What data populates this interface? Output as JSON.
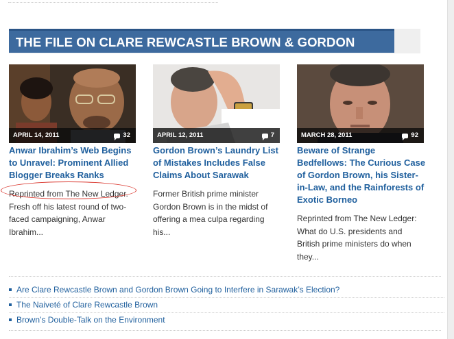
{
  "banner": {
    "title": "THE FILE ON CLARE REWCASTLE BROWN & GORDON BROWN"
  },
  "cards": [
    {
      "date": "APRIL 14, 2011",
      "comments": "32",
      "title": "Anwar Ibrahim’s Web Begins to Unravel: Prominent Allied Blogger Breaks Ranks",
      "excerpt": "Reprinted from The New Ledger. Fresh off his latest round of two-faced campaigning, Anwar Ibrahim..."
    },
    {
      "date": "APRIL 12, 2011",
      "comments": "7",
      "title": "Gordon Brown’s Laundry List of Mistakes Includes False Claims About Sarawak",
      "excerpt": "Former British prime minister Gordon Brown is in the midst of offering a mea culpa regarding his..."
    },
    {
      "date": "MARCH 28, 2011",
      "comments": "92",
      "title": "Beware of Strange Bedfellows: The Curious Case of Gordon Brown, his Sister-in-Law, and the Rainforests of Exotic Borneo",
      "excerpt": "Reprinted from The New Ledger: What do U.S. presidents and British prime ministers do when they..."
    }
  ],
  "related": [
    "Are Clare Rewcastle Brown and Gordon Brown Going to Interfere in Sarawak’s Election?",
    "The Naiveté of Clare Rewcastle Brown",
    "Brown’s Double-Talk on the Environment"
  ],
  "colors": {
    "banner": "#3d6a9e",
    "link": "#1f5f9d",
    "highlight_circle": "#d9342b"
  }
}
